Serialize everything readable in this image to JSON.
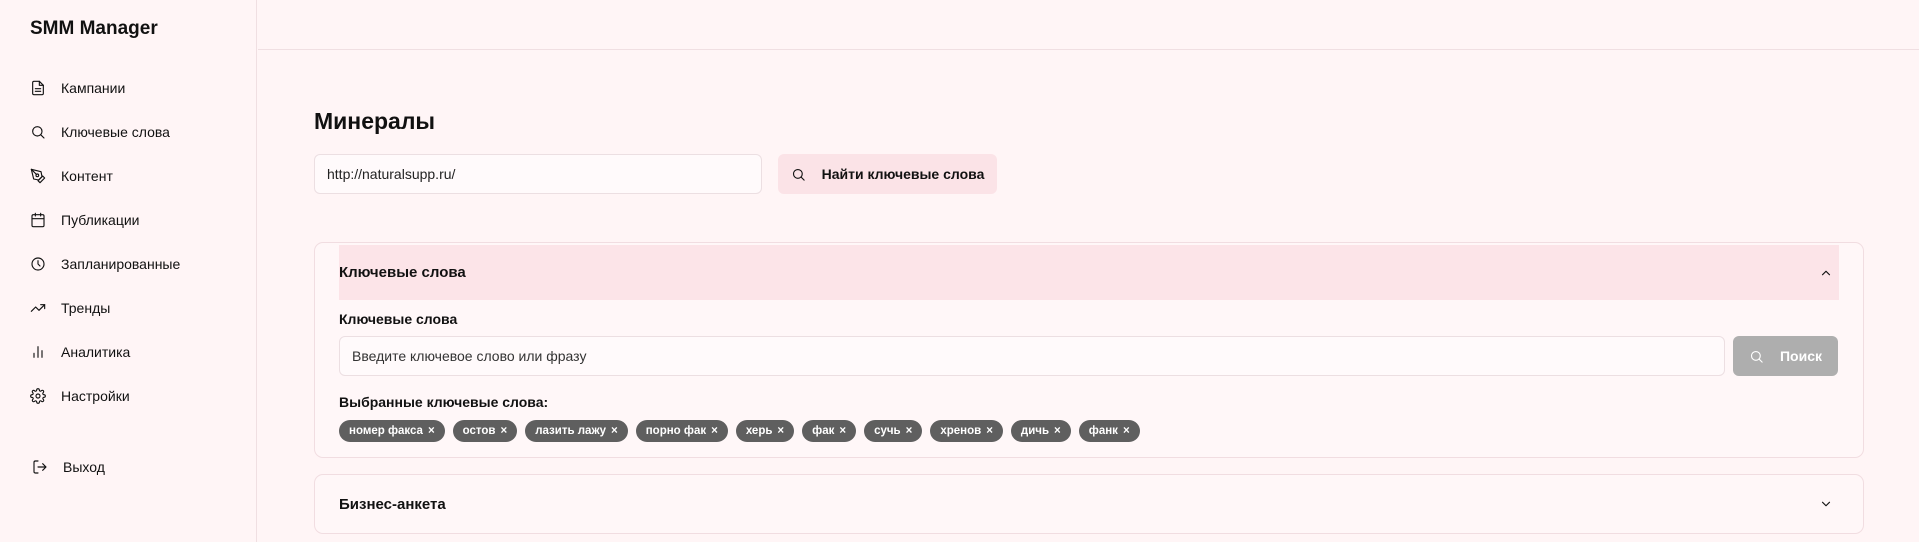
{
  "app": {
    "title": "SMM Manager"
  },
  "sidebar": {
    "items": [
      {
        "label": "Кампании",
        "icon": "document-icon"
      },
      {
        "label": "Ключевые слова",
        "icon": "search-icon"
      },
      {
        "label": "Контент",
        "icon": "pen-tool-icon"
      },
      {
        "label": "Публикации",
        "icon": "calendar-icon"
      },
      {
        "label": "Запланированные",
        "icon": "clock-icon"
      },
      {
        "label": "Тренды",
        "icon": "trending-up-icon"
      },
      {
        "label": "Аналитика",
        "icon": "bar-chart-icon"
      },
      {
        "label": "Настройки",
        "icon": "gear-icon"
      }
    ],
    "logout": {
      "label": "Выход",
      "icon": "logout-icon"
    }
  },
  "main": {
    "title": "Минералы",
    "url_input": {
      "value": "http://naturalsupp.ru/"
    },
    "find_button": {
      "label": "Найти ключевые слова",
      "icon": "search-icon"
    },
    "keywords_panel": {
      "title": "Ключевые слова",
      "expanded": true,
      "field_label": "Ключевые слова",
      "input_placeholder": "Введите ключевое слово или фразу",
      "search_button": {
        "label": "Поиск",
        "icon": "search-icon"
      },
      "selected_label": "Выбранные ключевые слова:",
      "tag_remove_symbol": "×",
      "selected_keywords": [
        "номер факса",
        "остов",
        "лазить лажу",
        "порно фак",
        "херь",
        "фак",
        "сучь",
        "хренов",
        "дичь",
        "фанк"
      ]
    },
    "business_panel": {
      "title": "Бизнес-анкета",
      "expanded": false
    }
  },
  "colors": {
    "background": "#fff5f6",
    "accent_soft": "#fce4e8",
    "tag_bg": "#5f5f5f",
    "disabled_button": "#aeaeae"
  }
}
